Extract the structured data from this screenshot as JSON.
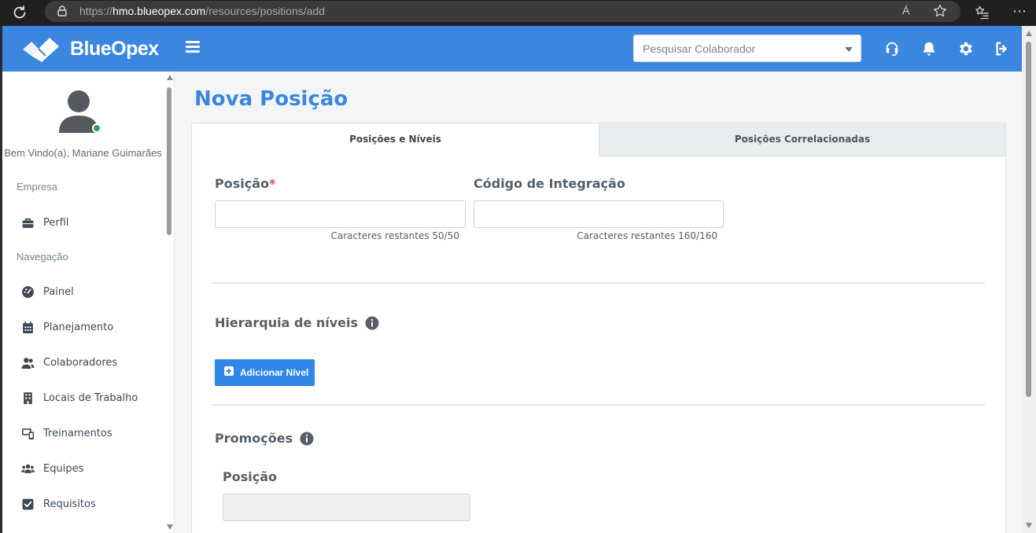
{
  "browser": {
    "url_scheme": "https://",
    "url_host": "hmo.blueopex.com",
    "url_path": "/resources/positions/add",
    "read_aloud": "Á"
  },
  "header": {
    "brand": "BlueOpex",
    "search_placeholder": "Pesquisar Colaborador",
    "icons": [
      "support-headset-icon",
      "notifications-bell-icon",
      "settings-gear-icon",
      "logout-icon"
    ],
    "brand_color": "#3a86e0"
  },
  "sidebar": {
    "welcome": "Bem Vindo(a), Mariane Guimarães",
    "sections": [
      {
        "label": "Empresa"
      },
      {
        "label": "Navegação"
      }
    ],
    "items": [
      {
        "label": "Perfil",
        "icon": "briefcase-icon"
      },
      {
        "label": "Painel",
        "icon": "dashboard-gauge-icon"
      },
      {
        "label": "Planejamento",
        "icon": "calendar-icon"
      },
      {
        "label": "Colaboradores",
        "icon": "users-icon"
      },
      {
        "label": "Locais de Trabalho",
        "icon": "building-icon"
      },
      {
        "label": "Treinamentos",
        "icon": "training-icon"
      },
      {
        "label": "Equipes",
        "icon": "team-icon"
      },
      {
        "label": "Requisitos",
        "icon": "checkbox-icon"
      }
    ]
  },
  "main": {
    "title": "Nova Posição",
    "tabs": [
      {
        "label": "Posições e Níveis",
        "active": true
      },
      {
        "label": "Posições Correlacionadas",
        "active": false
      }
    ],
    "position_field": {
      "label": "Posição",
      "required_mark": "*",
      "value": "",
      "counter": "Caracteres restantes 50/50"
    },
    "integration_field": {
      "label": "Código de Integração",
      "value": "",
      "counter": "Caracteres restantes 160/160"
    },
    "hierarchy": {
      "title": "Hierarquia de níveis",
      "add_button": "Adicionar Nível"
    },
    "promotions": {
      "title": "Promoções",
      "position_label": "Posição"
    }
  }
}
